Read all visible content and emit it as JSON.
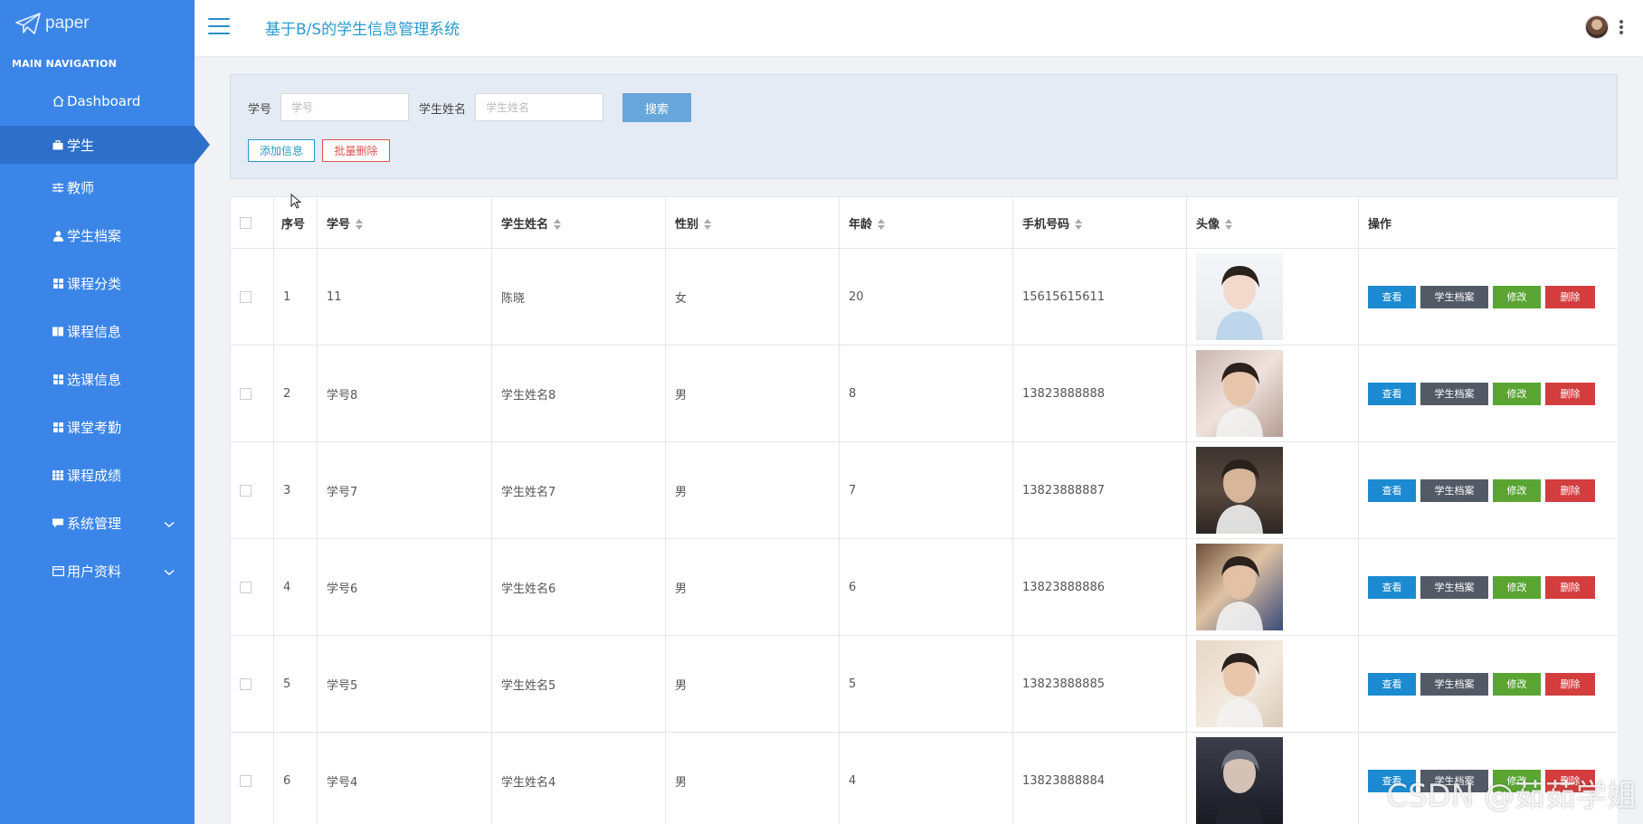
{
  "brand": {
    "name": "paper"
  },
  "sidebar": {
    "header": "MAIN NAVIGATION",
    "items": [
      {
        "label": "Dashboard",
        "icon": "home-icon"
      },
      {
        "label": "学生",
        "icon": "briefcase-icon",
        "active": true
      },
      {
        "label": "教师",
        "icon": "sliders-icon"
      },
      {
        "label": "学生档案",
        "icon": "user-icon"
      },
      {
        "label": "课程分类",
        "icon": "grid-icon"
      },
      {
        "label": "课程信息",
        "icon": "book-icon"
      },
      {
        "label": "选课信息",
        "icon": "grid-icon"
      },
      {
        "label": "课堂考勤",
        "icon": "grid-icon"
      },
      {
        "label": "课程成绩",
        "icon": "grid-icon"
      },
      {
        "label": "系统管理",
        "icon": "comment-icon",
        "expandable": true
      },
      {
        "label": "用户资料",
        "icon": "card-icon",
        "expandable": true
      }
    ]
  },
  "topbar": {
    "title": "基于B/S的学生信息管理系统"
  },
  "search": {
    "id_label": "学号",
    "id_placeholder": "学号",
    "name_label": "学生姓名",
    "name_placeholder": "学生姓名",
    "search_button": "搜索",
    "add_button": "添加信息",
    "batch_delete_button": "批量删除"
  },
  "table": {
    "columns": [
      "序号",
      "学号",
      "学生姓名",
      "性别",
      "年龄",
      "手机号码",
      "头像",
      "操作"
    ],
    "actions": {
      "view": "查看",
      "file": "学生档案",
      "edit": "修改",
      "delete": "删除"
    },
    "rows": [
      {
        "no": "1",
        "id": "11",
        "name": "陈晓",
        "gender": "女",
        "age": "20",
        "phone": "15615615611"
      },
      {
        "no": "2",
        "id": "学号8",
        "name": "学生姓名8",
        "gender": "男",
        "age": "8",
        "phone": "13823888888"
      },
      {
        "no": "3",
        "id": "学号7",
        "name": "学生姓名7",
        "gender": "男",
        "age": "7",
        "phone": "13823888887"
      },
      {
        "no": "4",
        "id": "学号6",
        "name": "学生姓名6",
        "gender": "男",
        "age": "6",
        "phone": "13823888886"
      },
      {
        "no": "5",
        "id": "学号5",
        "name": "学生姓名5",
        "gender": "男",
        "age": "5",
        "phone": "13823888885"
      },
      {
        "no": "6",
        "id": "学号4",
        "name": "学生姓名4",
        "gender": "男",
        "age": "4",
        "phone": "13823888884"
      }
    ]
  },
  "watermark": "CSDN @茹茹学姐",
  "colors": {
    "sidebar": "#3b85e8",
    "sidebar_active": "#2e6fca",
    "accent": "#2a9ad0"
  }
}
